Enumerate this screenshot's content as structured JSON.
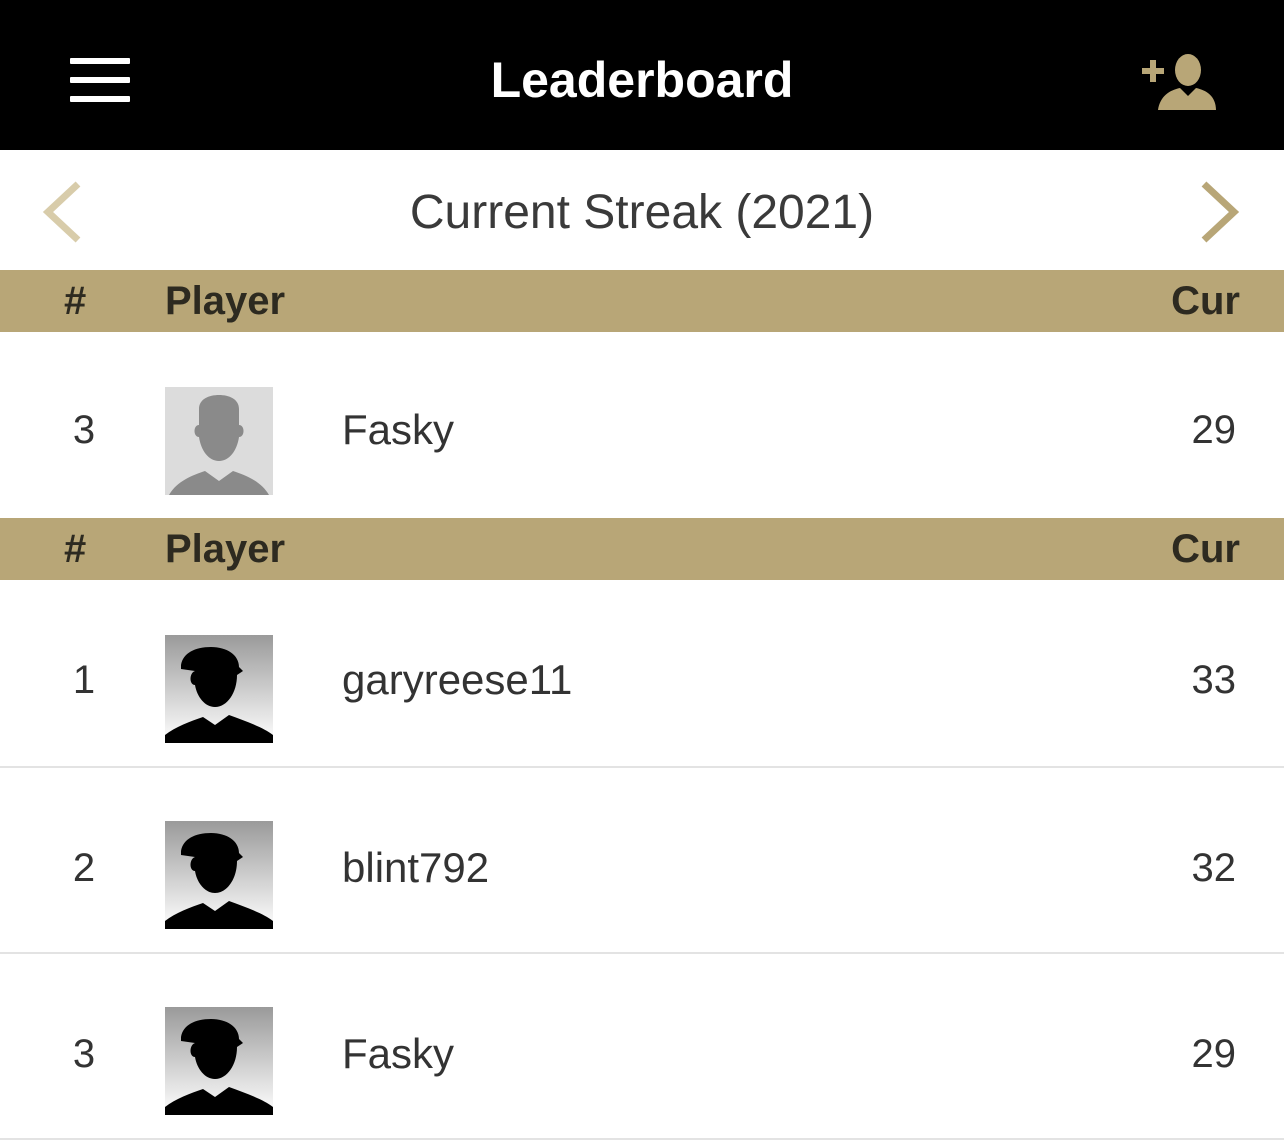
{
  "header": {
    "title": "Leaderboard",
    "menu_icon": "hamburger-menu-icon",
    "add_user_icon": "add-user-icon",
    "accent_color": "#b8a677"
  },
  "subheader": {
    "title": "Current Streak (2021)",
    "prev_icon": "chevron-left-icon",
    "next_icon": "chevron-right-icon"
  },
  "table": {
    "columns": {
      "rank": "#",
      "player": "Player",
      "score": "Cur"
    },
    "my_entry": {
      "rank": "3",
      "player": "Fasky",
      "score": "29"
    },
    "rows": [
      {
        "rank": "1",
        "player": "garyreese11",
        "score": "33"
      },
      {
        "rank": "2",
        "player": "blint792",
        "score": "32"
      },
      {
        "rank": "3",
        "player": "Fasky",
        "score": "29"
      }
    ]
  }
}
